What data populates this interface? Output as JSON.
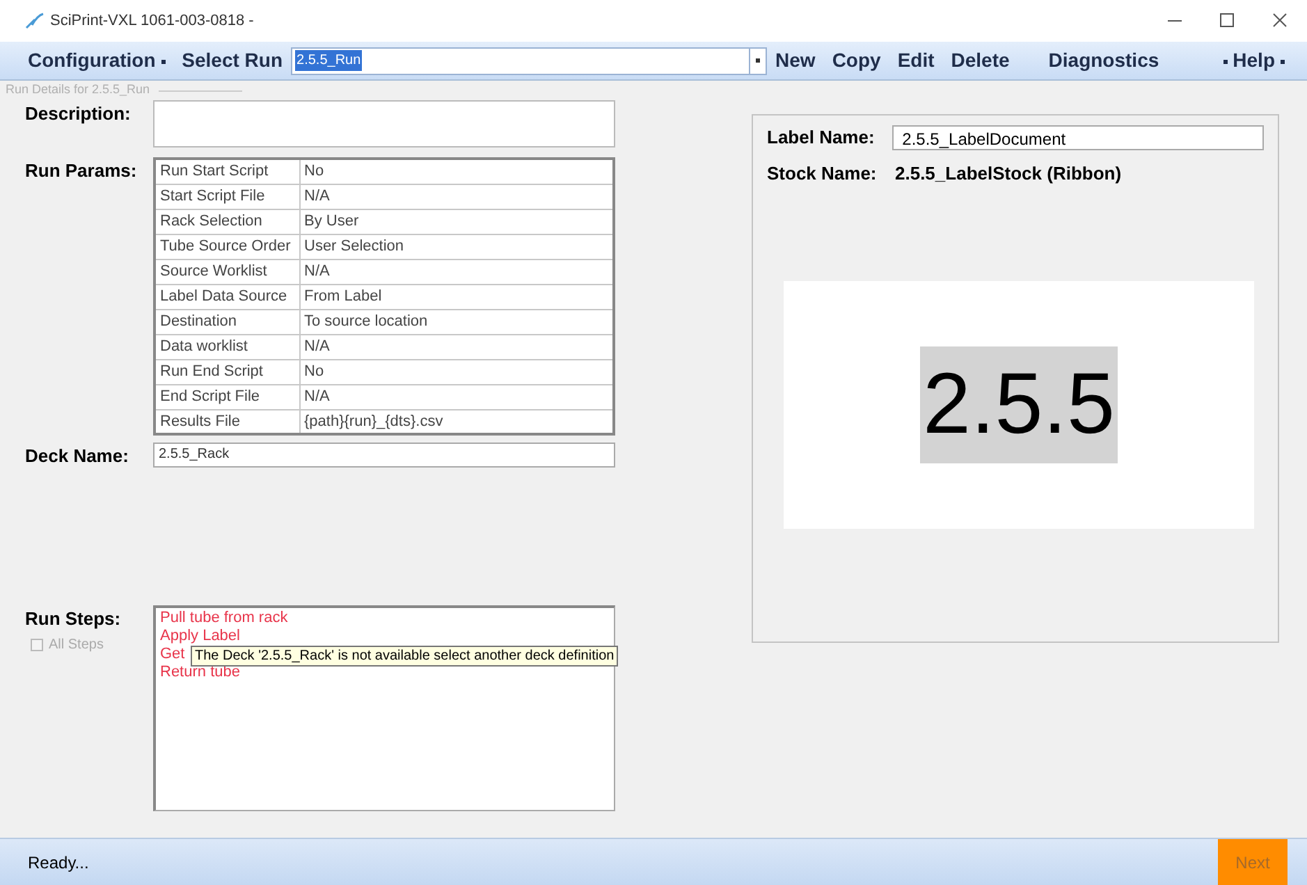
{
  "window": {
    "title": "SciPrint-VXL 1061-003-0818 -"
  },
  "menu": [
    {
      "kind": "dropdown",
      "label": "Configuration"
    },
    {
      "kind": "label",
      "label": "Select Run"
    }
  ],
  "run_select": {
    "value": "2.5.5_Run"
  },
  "actions": [
    "New",
    "Copy",
    "Edit",
    "Delete"
  ],
  "right_menu": [
    {
      "kind": "plain",
      "label": "Diagnostics"
    },
    {
      "kind": "dropdown",
      "label": "Help"
    }
  ],
  "group_title": "Run Details for 2.5.5_Run",
  "description": {
    "label": "Description:"
  },
  "run_params": {
    "label": "Run Params:",
    "rows": [
      {
        "name": "Run Start Script",
        "value": "No"
      },
      {
        "name": "Start Script File",
        "value": "N/A"
      },
      {
        "name": "Rack Selection",
        "value": "By User"
      },
      {
        "name": "Tube Source Order",
        "value": "User Selection"
      },
      {
        "name": "Source Worklist",
        "value": "N/A"
      },
      {
        "name": "Label Data Source",
        "value": "From Label"
      },
      {
        "name": "Destination",
        "value": "To source location"
      },
      {
        "name": "Data worklist",
        "value": "N/A"
      },
      {
        "name": "Run End Script",
        "value": "No"
      },
      {
        "name": "End Script File",
        "value": "N/A"
      },
      {
        "name": "Results File",
        "value": "{path}{run}_{dts}.csv"
      }
    ]
  },
  "deck": {
    "label": "Deck Name:",
    "value": "2.5.5_Rack"
  },
  "run_steps": {
    "label": "Run Steps:",
    "all_steps": {
      "label": "All Steps",
      "checked": false,
      "disabled": true
    },
    "steps": [
      {
        "text": "Pull tube from rack",
        "error": true
      },
      {
        "text": "Apply Label",
        "error": true
      },
      {
        "text": "Get",
        "error": true
      },
      {
        "text": "Return tube",
        "error": true
      }
    ]
  },
  "tooltip": "The Deck '2.5.5_Rack' is not available select another deck definition",
  "label_panel": {
    "label_name_label": "Label Name:",
    "label_name": "2.5.5_LabelDocument",
    "stock_label": "Stock Name:",
    "stock_name": "2.5.5_LabelStock (Ribbon)",
    "preview_text": "2.5.5"
  },
  "status_bar": {
    "text": "Ready...",
    "next": {
      "label": "Next",
      "disabled": true
    }
  }
}
